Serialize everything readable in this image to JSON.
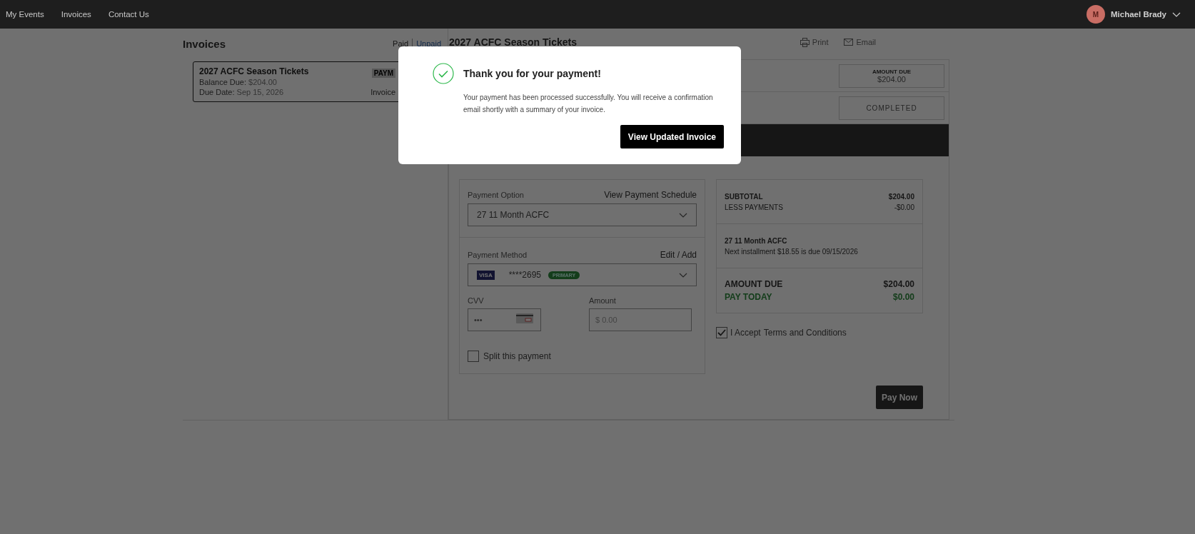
{
  "nav": {
    "items": [
      {
        "label": "My Events"
      },
      {
        "label": "Invoices"
      },
      {
        "label": "Contact Us"
      }
    ]
  },
  "user": {
    "initial": "M",
    "name": "Michael Brady"
  },
  "invoices": {
    "title": "Invoices",
    "filters": [
      {
        "label": "Paid",
        "selected": false
      },
      {
        "label": "Unpaid",
        "selected": true
      }
    ],
    "items": [
      {
        "title": "2027 ACFC Season Tickets",
        "balance_label": "Balance Due:",
        "balance": "$204.00",
        "due_label": "Due Date:",
        "due": "Sep 15, 2026",
        "badge": "PAYM",
        "link": "Invoice",
        "selected": true
      }
    ]
  },
  "invoice_detail": {
    "title": "2027 ACFC Season Tickets",
    "actions": [
      {
        "label": "Print",
        "kind": "print"
      },
      {
        "label": "Email",
        "kind": "email"
      }
    ],
    "amount_due_label": "AMOUNT DUE",
    "amount_due": "$204.00",
    "status": "COMPLETED"
  },
  "payment_form": {
    "option_label": "Payment Option",
    "schedule_link": "View Payment Schedule",
    "option_value": "27 11 Month ACFC",
    "method_label": "Payment Method",
    "edit_link": "Edit / Add",
    "card": {
      "brand": "VISA",
      "masked": "****2695",
      "badge": "PRIMARY"
    },
    "cvv_label": "CVV",
    "cvv_value": "•••",
    "amount_label": "Amount",
    "amount_placeholder": "$ 0.00",
    "split": {
      "label": "Split this payment",
      "checked": false
    }
  },
  "summary": {
    "subtotal_label": "SUBTOTAL",
    "subtotal": "$204.00",
    "less_label": "LESS PAYMENTS",
    "less": "-$0.00",
    "plan_name": "27 11 Month ACFC",
    "plan_note": "Next installment $18.55 is due 09/15/2026",
    "amount_due_label": "AMOUNT DUE",
    "amount_due": "$204.00",
    "pay_today_label": "PAY TODAY",
    "pay_today": "$0.00"
  },
  "terms": {
    "prefix": "I Accept",
    "link": "Terms and Conditions",
    "checked": true
  },
  "pay_button": "Pay Now",
  "modal": {
    "title": "Thank you for your payment!",
    "message": "Your payment has been processed successfully. You will receive a confirmation email shortly with a summary of your invoice.",
    "button": "View Updated Invoice"
  }
}
